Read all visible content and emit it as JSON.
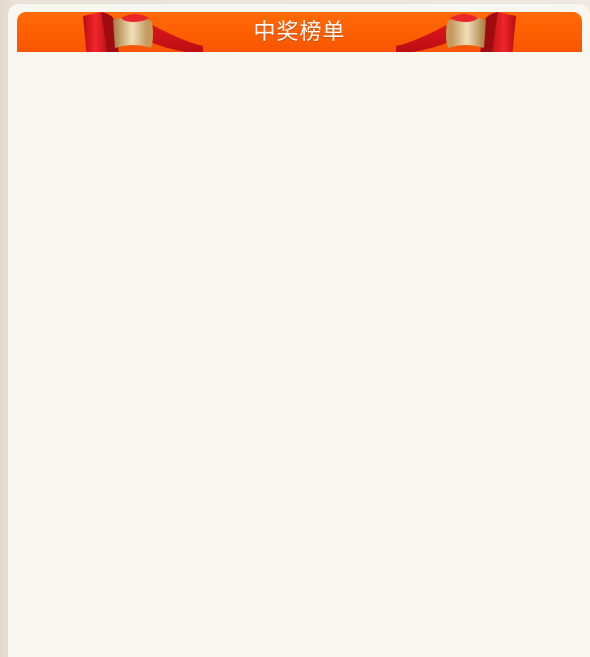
{
  "leaderboard": {
    "title": "中奖榜单",
    "entries": []
  },
  "colors": {
    "header_orange": "#fd6200",
    "ribbon_red": "#d5161a",
    "ribbon_gold": "#e8c793",
    "panel_bg": "#f7f7f0"
  },
  "icons": {
    "left_decoration": "ribbon-scroll-icon",
    "right_decoration": "ribbon-scroll-icon"
  }
}
